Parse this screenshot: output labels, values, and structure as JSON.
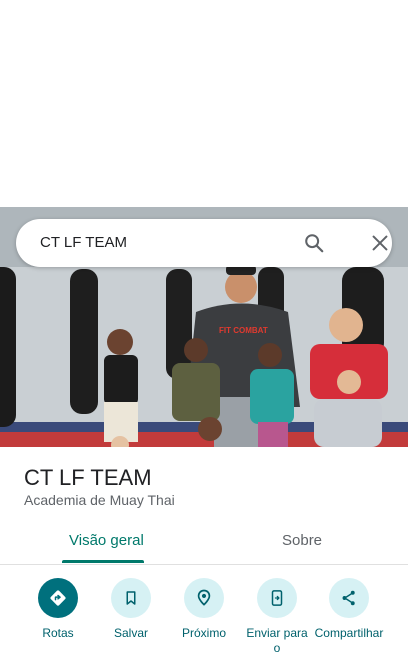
{
  "search": {
    "query": "CT LF TEAM"
  },
  "place": {
    "name": "CT LF TEAM",
    "category": "Academia de Muay Thai"
  },
  "tabs": [
    {
      "label": "Visão geral",
      "active": true
    },
    {
      "label": "Sobre",
      "active": false
    }
  ],
  "actions": [
    {
      "label": "Rotas",
      "icon": "directions-icon"
    },
    {
      "label": "Salvar",
      "icon": "bookmark-icon"
    },
    {
      "label": "Próximo",
      "icon": "nearby-icon"
    },
    {
      "label": "Enviar para o",
      "icon": "send-to-phone-icon"
    },
    {
      "label": "Compartilhar",
      "icon": "share-icon"
    }
  ],
  "photo": {
    "shirt_text": "FIT COMBAT"
  },
  "colors": {
    "accent": "#00796b",
    "action_bg": "#d6f1f4",
    "primary_action": "#00707d"
  }
}
